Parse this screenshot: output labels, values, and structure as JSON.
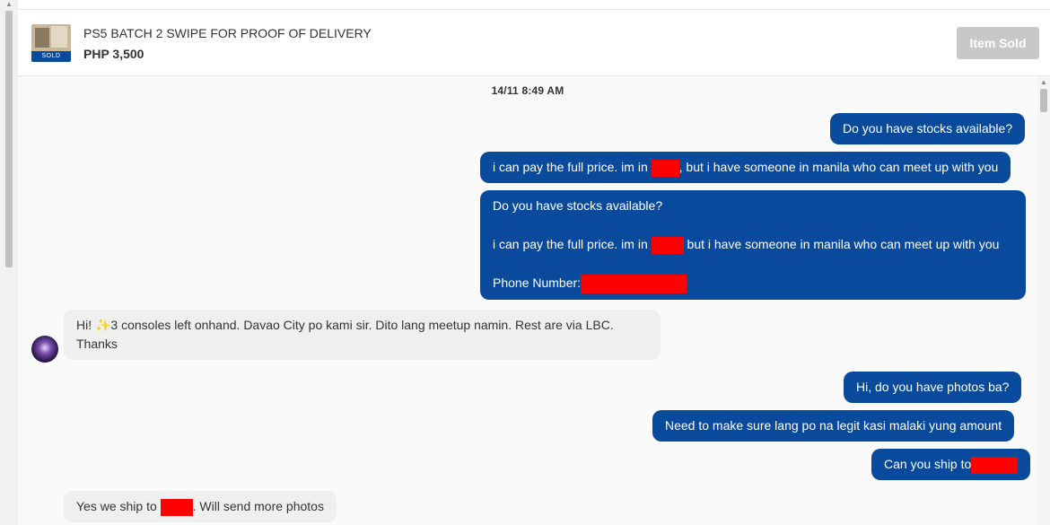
{
  "listing": {
    "title": "PS5 BATCH 2 SWIPE FOR PROOF OF DELIVERY",
    "price": "PHP 3,500",
    "thumb_badge": "SOLD",
    "status_button": "Item Sold"
  },
  "chat": {
    "timestamp": "14/11  8:49 AM",
    "messages": {
      "m1": {
        "text": "Do you have stocks available?"
      },
      "m2": {
        "before": "i can pay the full price. im in ",
        "after": ", but i have someone in manila who can meet up with you"
      },
      "m3": {
        "line1": "Do you have stocks available?",
        "line2_before": "i can pay the full price. im in ",
        "line2_after": " but i have someone in manila who can meet up with you",
        "line3": "Phone Number:"
      },
      "m4": {
        "text": "Hi! ✨3 consoles left onhand. Davao City po kami sir. Dito lang meetup namin. Rest are via LBC. Thanks"
      },
      "m5": {
        "text": "Hi, do you have photos ba?"
      },
      "m6": {
        "text": "Need to make sure lang po na legit kasi malaki yung amount"
      },
      "m7": {
        "before": "Can you ship to"
      },
      "m8": {
        "before": "Yes we ship to ",
        "after": ". Will send more photos"
      }
    }
  },
  "colors": {
    "outgoing_bubble": "#0a4a9c",
    "incoming_bubble": "#efefef",
    "redaction": "#ff0000"
  }
}
